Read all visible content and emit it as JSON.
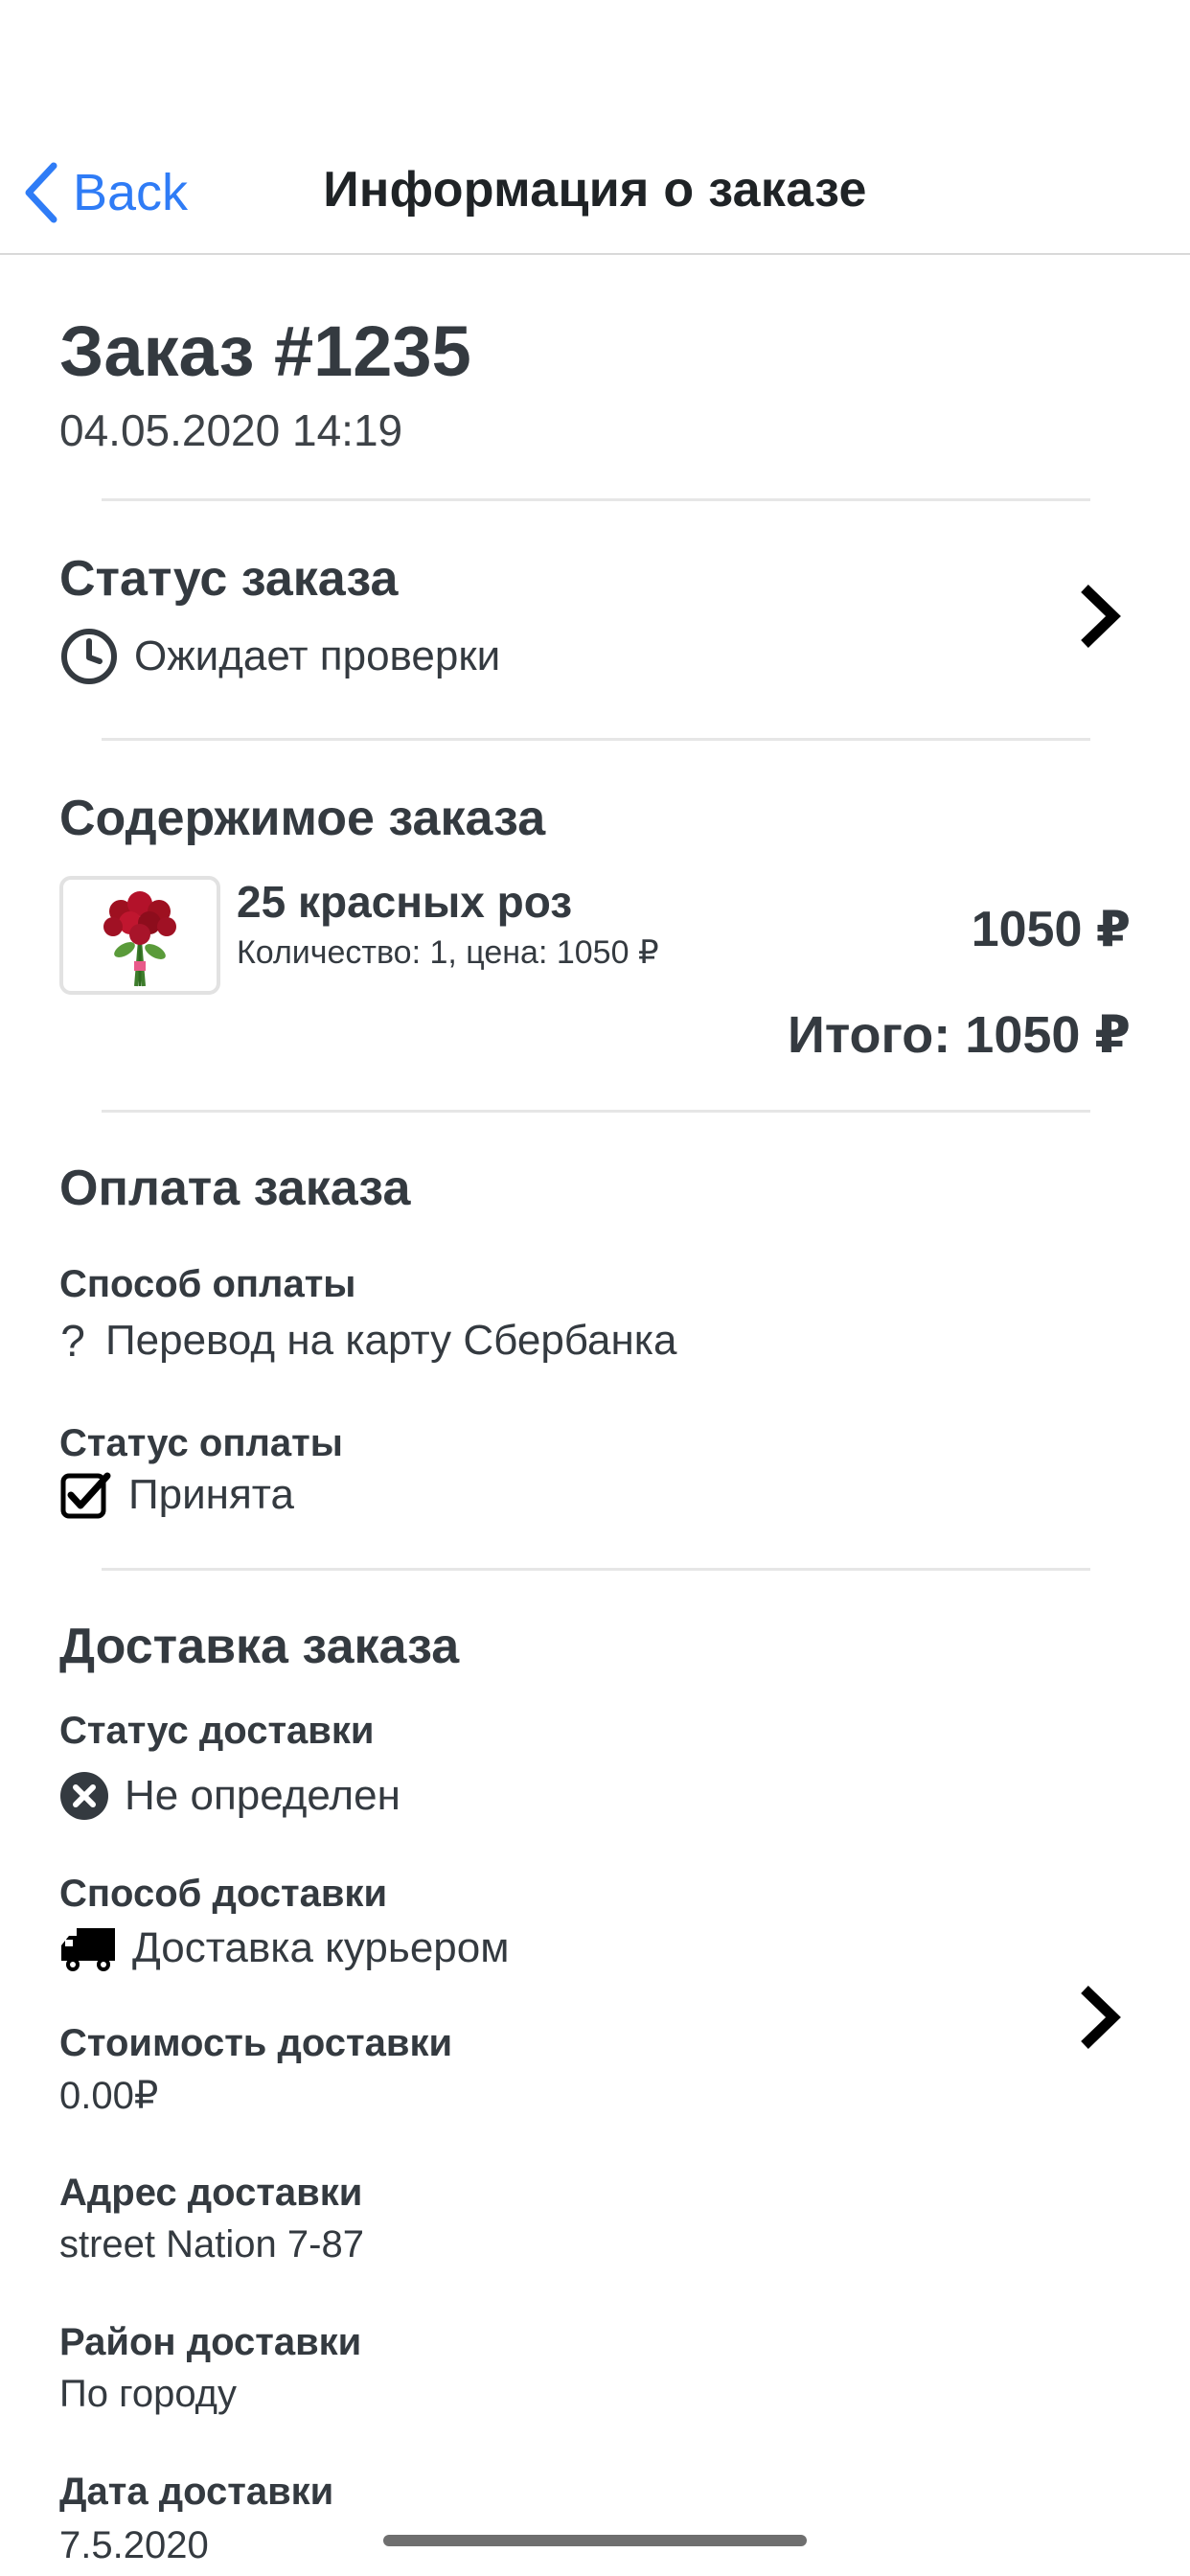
{
  "nav": {
    "back_label": "Back",
    "title": "Информация о заказе"
  },
  "order": {
    "title": "Заказ #1235",
    "datetime": "04.05.2020 14:19"
  },
  "status_section": {
    "title": "Статус заказа",
    "status_text": "Ожидает проверки",
    "status_icon": "clock-icon"
  },
  "contents_section": {
    "title": "Содержимое заказа",
    "items": [
      {
        "name": "25 красных роз",
        "meta": "Количество: 1, цена: 1050 ₽",
        "price": "1050 ₽"
      }
    ],
    "total": "Итого: 1050 ₽"
  },
  "payment_section": {
    "title": "Оплата заказа",
    "method_label": "Способ оплаты",
    "method_value": "Перевод на карту Сбербанка",
    "method_icon": "question-icon",
    "status_label": "Статус оплаты",
    "status_value": "Принята",
    "status_icon": "checkbox-checked-icon"
  },
  "delivery_section": {
    "title": "Доставка заказа",
    "status_label": "Статус доставки",
    "status_value": "Не определен",
    "status_icon": "x-circle-icon",
    "method_label": "Способ доставки",
    "method_value": "Доставка курьером",
    "method_icon": "truck-icon",
    "cost_label": "Стоимость доставки",
    "cost_value": "0.00₽",
    "address_label": "Адрес доставки",
    "address_value": "street Nation 7-87",
    "district_label": "Район доставки",
    "district_value": "По городу",
    "date_label": "Дата доставки",
    "date_value": "7.5.2020"
  },
  "colors": {
    "accent": "#2f7cf6",
    "text": "#343a40",
    "divider": "#e6e6e6"
  }
}
